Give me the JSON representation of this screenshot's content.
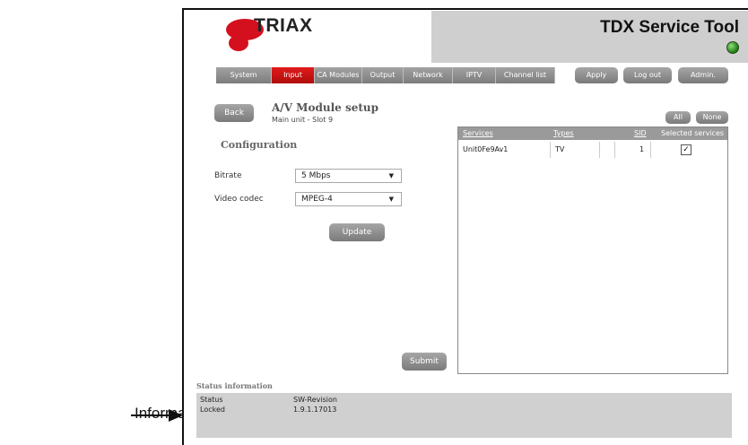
{
  "annotation": {
    "label": "Informacja"
  },
  "brand": {
    "logo_text": "TRIAX",
    "app_title": "TDX Service Tool"
  },
  "nav": {
    "tabs": [
      "System",
      "Input",
      "CA Modules",
      "Output",
      "Network",
      "IPTV",
      "Channel list"
    ],
    "active": "Input",
    "apply": "Apply",
    "logout": "Log out",
    "admin": "Admin."
  },
  "page": {
    "back": "Back",
    "title": "A/V Module setup",
    "subtitle": "Main unit - Slot 9"
  },
  "config": {
    "title": "Configuration",
    "bitrate_label": "Bitrate",
    "bitrate_value": "5 Mbps",
    "codec_label": "Video codec",
    "codec_value": "MPEG-4",
    "update": "Update",
    "submit": "Submit"
  },
  "services": {
    "all": "All",
    "none": "None",
    "columns": [
      "Services",
      "Types",
      "SID",
      "Selected services"
    ],
    "rows": [
      {
        "service": "Unit0Fe9Av1",
        "type": "TV",
        "sid": "1",
        "selected": true
      }
    ]
  },
  "status": {
    "title": "Status information",
    "label1": "Status",
    "value1": "Locked",
    "label2": "SW-Revision",
    "value2": "1.9.1.17013"
  },
  "colors": {
    "accent_red": "#d4101e",
    "led_green": "#1e7a12"
  }
}
